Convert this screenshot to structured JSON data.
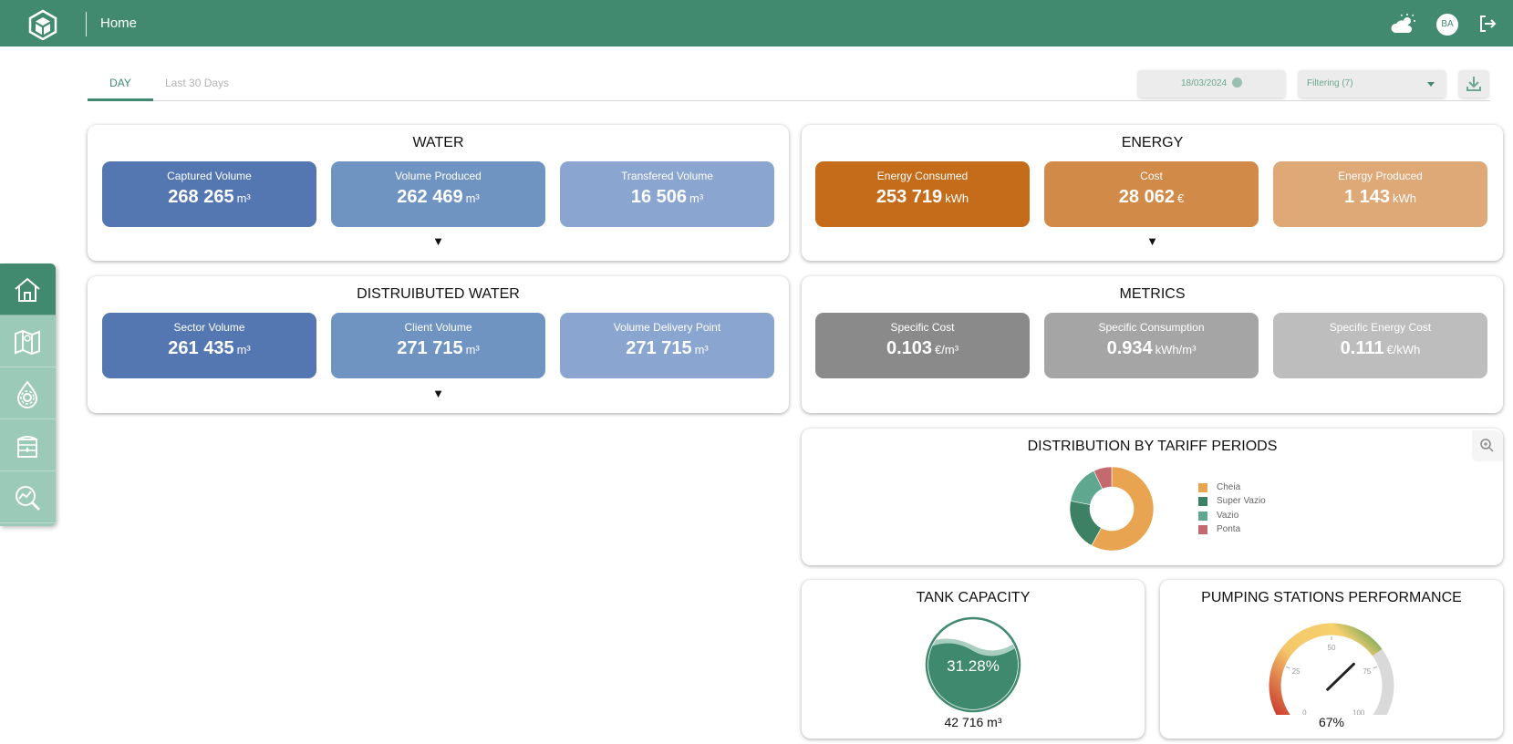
{
  "header": {
    "title": "Home",
    "avatar": "BA"
  },
  "tabs": [
    {
      "label": "DAY"
    },
    {
      "label": "Last 30 Days"
    }
  ],
  "toolbar": {
    "date": "18/03/2024",
    "filter": "Filtering (7)"
  },
  "water": {
    "title": "WATER",
    "metrics": [
      {
        "label": "Captured Volume",
        "value": "268 265",
        "unit": "m³"
      },
      {
        "label": "Volume Produced",
        "value": "262 469",
        "unit": "m³"
      },
      {
        "label": "Transfered Volume",
        "value": "16 506",
        "unit": "m³"
      }
    ]
  },
  "energy": {
    "title": "ENERGY",
    "metrics": [
      {
        "label": "Energy Consumed",
        "value": "253 719",
        "unit": "kWh"
      },
      {
        "label": "Cost",
        "value": "28 062",
        "unit": "€"
      },
      {
        "label": "Energy Produced",
        "value": "1 143",
        "unit": "kWh"
      }
    ]
  },
  "distributed": {
    "title": "DISTRUIBUTED WATER",
    "metrics": [
      {
        "label": "Sector Volume",
        "value": "261 435",
        "unit": "m³"
      },
      {
        "label": "Client Volume",
        "value": "271 715",
        "unit": "m³"
      },
      {
        "label": "Volume Delivery Point",
        "value": "271 715",
        "unit": "m³"
      }
    ]
  },
  "metrics": {
    "title": "METRICS",
    "metrics": [
      {
        "label": "Specific Cost",
        "value": "0.103",
        "unit": "€/m³"
      },
      {
        "label": "Specific Consumption",
        "value": "0.934",
        "unit": "kWh/m³"
      },
      {
        "label": "Specific Energy Cost",
        "value": "0.111",
        "unit": "€/kWh"
      }
    ]
  },
  "tariff": {
    "title": "DISTRIBUTION BY TARIFF PERIODS",
    "series": [
      {
        "name": "Cheia",
        "value": 58,
        "color": "#e8a450"
      },
      {
        "name": "Super Vazio",
        "value": 20,
        "color": "#3c8163"
      },
      {
        "name": "Vazio",
        "value": 15,
        "color": "#5fa88f"
      },
      {
        "name": "Ponta",
        "value": 7,
        "color": "#c46a6e"
      }
    ]
  },
  "tank": {
    "title": "TANK CAPACITY",
    "percent_label": "31.28%",
    "fill_fraction": 0.3128,
    "volume": "42 716 m³"
  },
  "pumping": {
    "title": "PUMPING STATIONS PERFORMANCE",
    "value": 67,
    "value_label": "67%",
    "ticks": [
      "0",
      "25",
      "50",
      "75",
      "100"
    ]
  }
}
